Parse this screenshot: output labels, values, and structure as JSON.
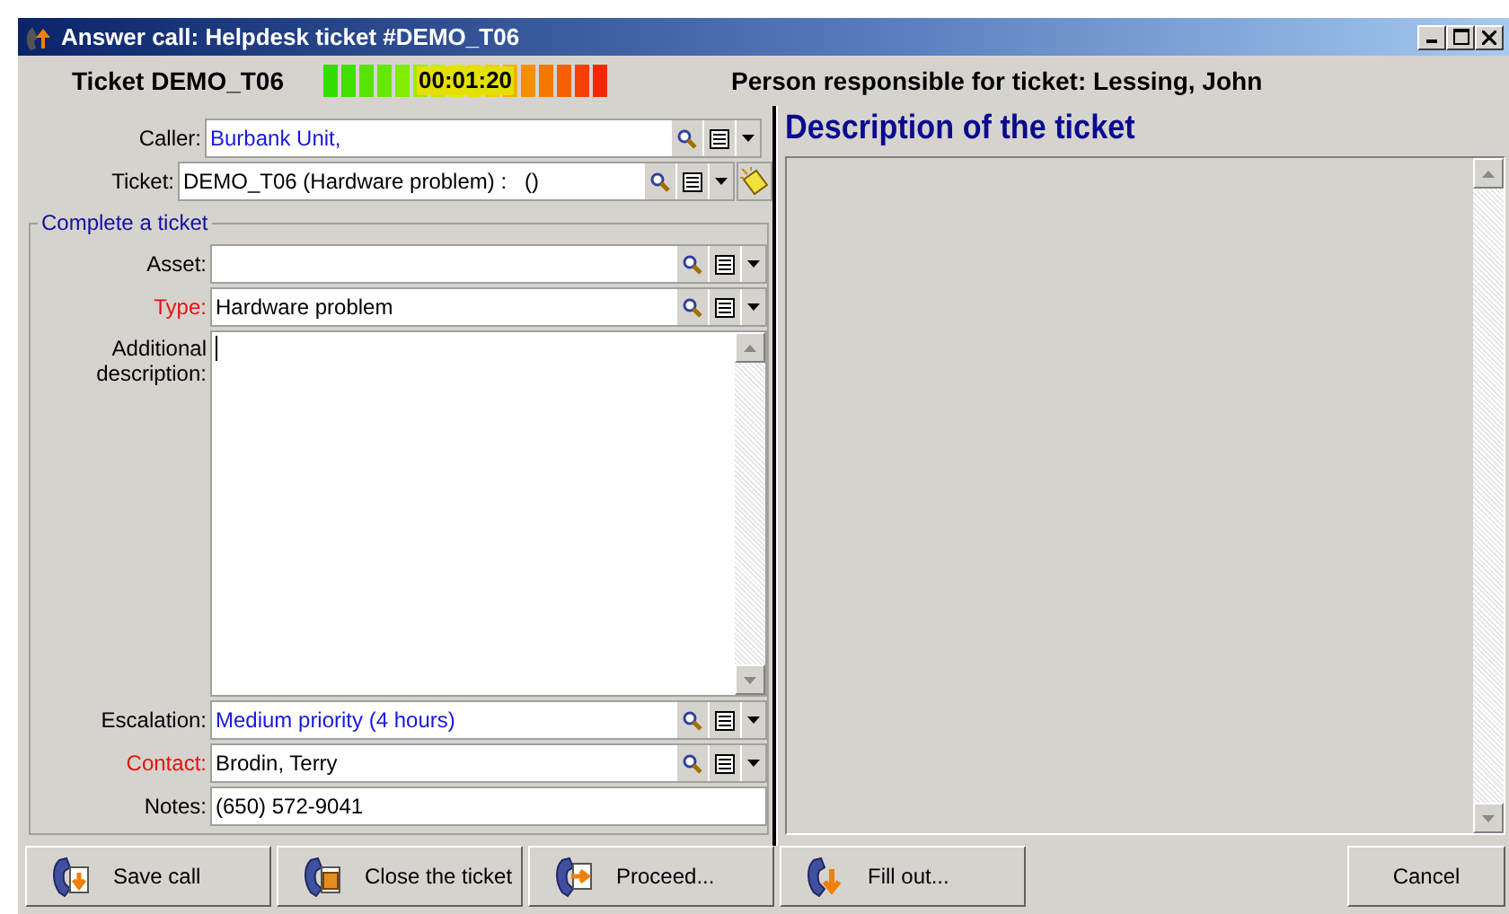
{
  "window": {
    "title": "Answer call: Helpdesk ticket #DEMO_T06"
  },
  "header": {
    "ticket": "Ticket DEMO_T06",
    "timer": "00:01:20",
    "responsible": "Person responsible for ticket: Lessing, John"
  },
  "top_fields": [
    {
      "kind": "lookup",
      "label": "Caller:",
      "value": "Burbank Unit,",
      "required": false,
      "linked": true
    },
    {
      "kind": "lookup",
      "label": "Ticket:",
      "value": "DEMO_T06 (Hardware problem) :   ()",
      "required": false,
      "wizard": true
    }
  ],
  "group": {
    "title": "Complete a ticket",
    "fields": [
      {
        "kind": "lookup",
        "label": "Asset:",
        "required": false
      },
      {
        "kind": "lookup",
        "label": "Type:",
        "value": "Hardware problem",
        "required": true
      },
      {
        "kind": "memo",
        "label": "Additional description:",
        "required": false
      },
      {
        "kind": "lookup",
        "label": "Escalation:",
        "value": "Medium priority (4 hours)",
        "required": false,
        "linked": true
      },
      {
        "kind": "lookup",
        "label": "Contact:",
        "value": "Brodin, Terry",
        "required": true
      },
      {
        "kind": "plain",
        "label": "Notes:",
        "value": "(650) 572-9041",
        "required": false
      }
    ]
  },
  "description": {
    "title": "Description of the ticket"
  },
  "buttons": [
    {
      "label": "Save call",
      "kind": "icon"
    },
    {
      "label": "Close the ticket",
      "kind": "icon"
    },
    {
      "label": "Proceed...",
      "kind": "icon"
    },
    {
      "label": "Fill out...",
      "kind": "icon"
    },
    {
      "label": "Cancel",
      "kind": "plain"
    }
  ]
}
